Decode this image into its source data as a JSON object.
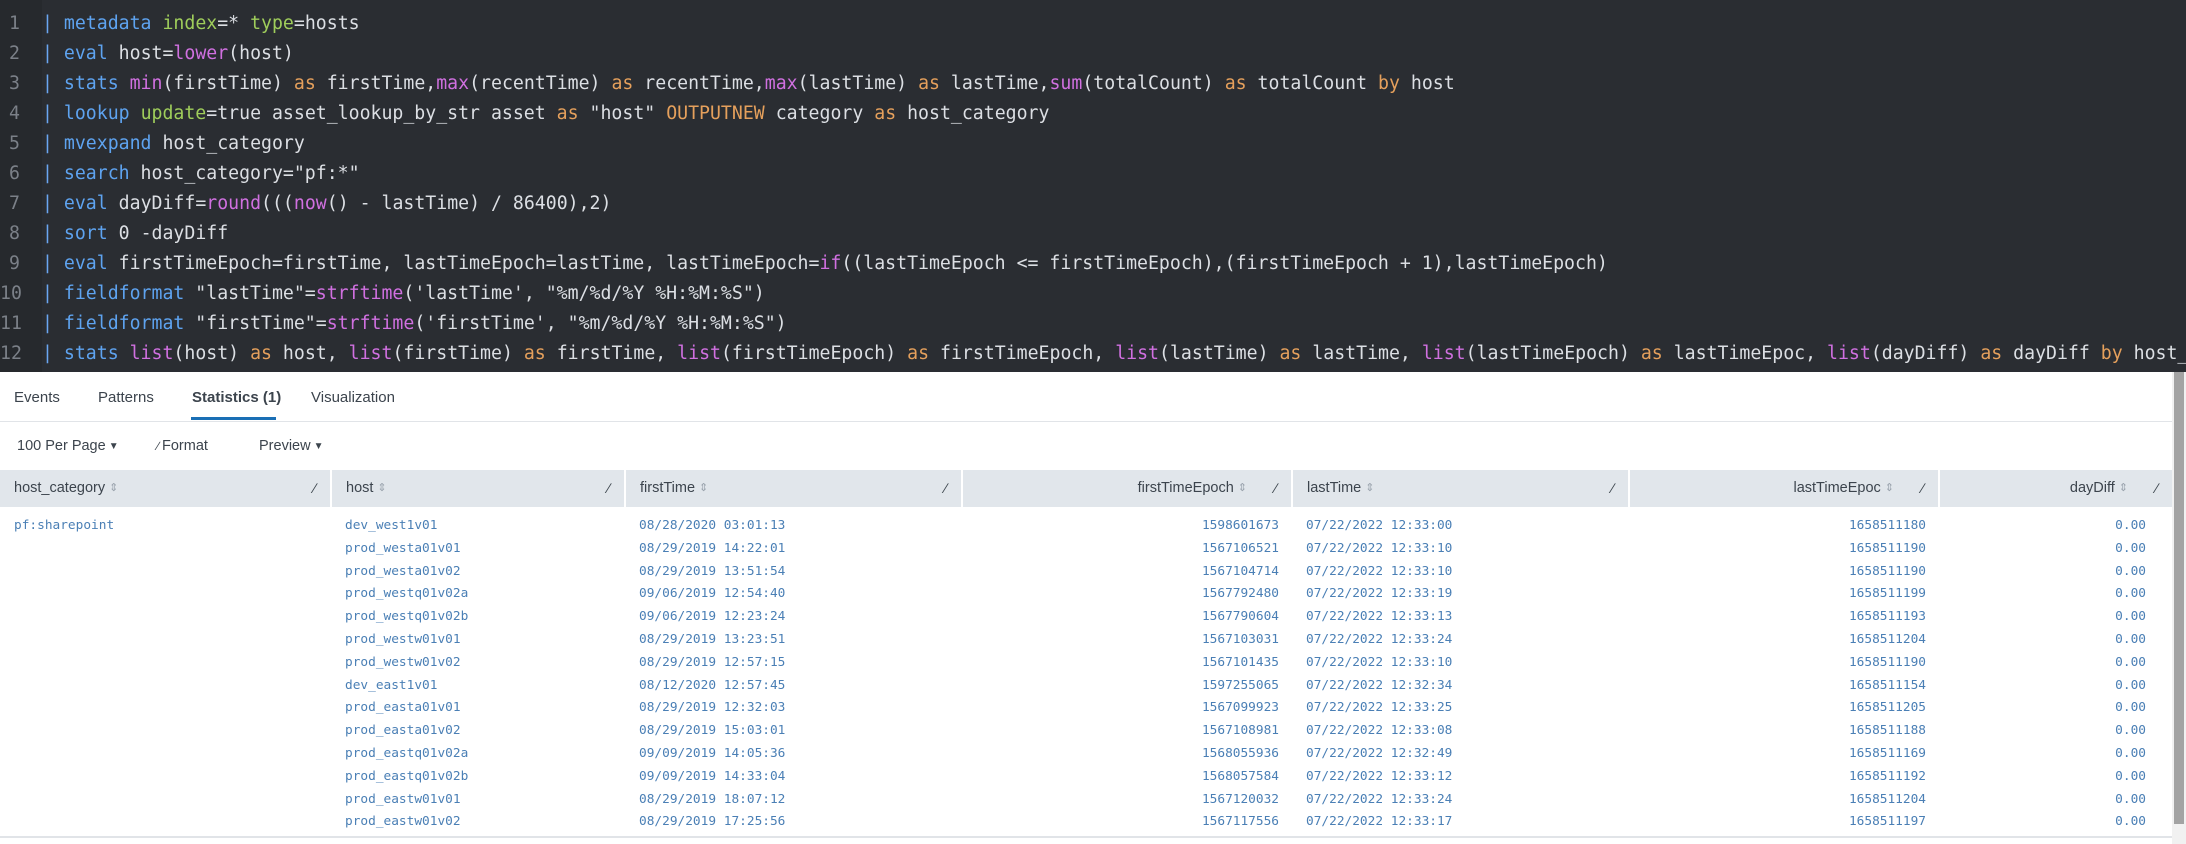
{
  "editor": {
    "lines": [
      {
        "num": "1",
        "tokens": [
          [
            "pipe",
            "| "
          ],
          [
            "cmd",
            "metadata"
          ],
          [
            "txt",
            " "
          ],
          [
            "arg",
            "index"
          ],
          [
            "txt",
            "=* "
          ],
          [
            "arg",
            "type"
          ],
          [
            "txt",
            "=hosts"
          ]
        ]
      },
      {
        "num": "2",
        "tokens": [
          [
            "pipe",
            "| "
          ],
          [
            "cmd",
            "eval"
          ],
          [
            "txt",
            " host="
          ],
          [
            "fn",
            "lower"
          ],
          [
            "txt",
            "(host)"
          ]
        ]
      },
      {
        "num": "3",
        "tokens": [
          [
            "pipe",
            "| "
          ],
          [
            "cmd",
            "stats"
          ],
          [
            "txt",
            " "
          ],
          [
            "fn",
            "min"
          ],
          [
            "txt",
            "(firstTime) "
          ],
          [
            "kw",
            "as"
          ],
          [
            "txt",
            " firstTime,"
          ],
          [
            "fn",
            "max"
          ],
          [
            "txt",
            "(recentTime) "
          ],
          [
            "kw",
            "as"
          ],
          [
            "txt",
            " recentTime,"
          ],
          [
            "fn",
            "max"
          ],
          [
            "txt",
            "(lastTime) "
          ],
          [
            "kw",
            "as"
          ],
          [
            "txt",
            " lastTime,"
          ],
          [
            "fn",
            "sum"
          ],
          [
            "txt",
            "(totalCount) "
          ],
          [
            "kw",
            "as"
          ],
          [
            "txt",
            " totalCount "
          ],
          [
            "kw",
            "by"
          ],
          [
            "txt",
            " host"
          ]
        ]
      },
      {
        "num": "4",
        "tokens": [
          [
            "pipe",
            "| "
          ],
          [
            "cmd",
            "lookup"
          ],
          [
            "txt",
            " "
          ],
          [
            "arg",
            "update"
          ],
          [
            "txt",
            "=true asset_lookup_by_str asset "
          ],
          [
            "kw",
            "as"
          ],
          [
            "txt",
            " \"host\" "
          ],
          [
            "kw",
            "OUTPUTNEW"
          ],
          [
            "txt",
            " category "
          ],
          [
            "kw",
            "as"
          ],
          [
            "txt",
            " host_category"
          ]
        ]
      },
      {
        "num": "5",
        "tokens": [
          [
            "pipe",
            "| "
          ],
          [
            "cmd",
            "mvexpand"
          ],
          [
            "txt",
            " host_category"
          ]
        ]
      },
      {
        "num": "6",
        "tokens": [
          [
            "pipe",
            "| "
          ],
          [
            "cmd",
            "search"
          ],
          [
            "txt",
            " host_category=\"pf:*\""
          ]
        ]
      },
      {
        "num": "7",
        "tokens": [
          [
            "pipe",
            "| "
          ],
          [
            "cmd",
            "eval"
          ],
          [
            "txt",
            " dayDiff="
          ],
          [
            "fn",
            "round"
          ],
          [
            "txt",
            "((("
          ],
          [
            "fn",
            "now"
          ],
          [
            "txt",
            "() - lastTime) / 86400),2)"
          ]
        ]
      },
      {
        "num": "8",
        "tokens": [
          [
            "pipe",
            "| "
          ],
          [
            "cmd",
            "sort"
          ],
          [
            "txt",
            " 0 -dayDiff"
          ]
        ]
      },
      {
        "num": "9",
        "tokens": [
          [
            "pipe",
            "| "
          ],
          [
            "cmd",
            "eval"
          ],
          [
            "txt",
            " firstTimeEpoch=firstTime, lastTimeEpoch=lastTime, lastTimeEpoch="
          ],
          [
            "fn",
            "if"
          ],
          [
            "txt",
            "((lastTimeEpoch <= firstTimeEpoch),(firstTimeEpoch + 1),lastTimeEpoch)"
          ]
        ]
      },
      {
        "num": "10",
        "tokens": [
          [
            "pipe",
            "| "
          ],
          [
            "cmd",
            "fieldformat"
          ],
          [
            "txt",
            " \"lastTime\"="
          ],
          [
            "fn",
            "strftime"
          ],
          [
            "txt",
            "('lastTime', \"%m/%d/%Y %H:%M:%S\")"
          ]
        ]
      },
      {
        "num": "11",
        "tokens": [
          [
            "pipe",
            "| "
          ],
          [
            "cmd",
            "fieldformat"
          ],
          [
            "txt",
            " \"firstTime\"="
          ],
          [
            "fn",
            "strftime"
          ],
          [
            "txt",
            "('firstTime', \"%m/%d/%Y %H:%M:%S\")"
          ]
        ]
      },
      {
        "num": "12",
        "tokens": [
          [
            "pipe",
            "| "
          ],
          [
            "cmd",
            "stats"
          ],
          [
            "txt",
            " "
          ],
          [
            "fn",
            "list"
          ],
          [
            "txt",
            "(host) "
          ],
          [
            "kw",
            "as"
          ],
          [
            "txt",
            " host, "
          ],
          [
            "fn",
            "list"
          ],
          [
            "txt",
            "(firstTime) "
          ],
          [
            "kw",
            "as"
          ],
          [
            "txt",
            " firstTime, "
          ],
          [
            "fn",
            "list"
          ],
          [
            "txt",
            "(firstTimeEpoch) "
          ],
          [
            "kw",
            "as"
          ],
          [
            "txt",
            " firstTimeEpoch, "
          ],
          [
            "fn",
            "list"
          ],
          [
            "txt",
            "(lastTime) "
          ],
          [
            "kw",
            "as"
          ],
          [
            "txt",
            " lastTime, "
          ],
          [
            "fn",
            "list"
          ],
          [
            "txt",
            "(lastTimeEpoch) "
          ],
          [
            "kw",
            "as"
          ],
          [
            "txt",
            " lastTimeEpoc, "
          ],
          [
            "fn",
            "list"
          ],
          [
            "txt",
            "(dayDiff) "
          ],
          [
            "kw",
            "as"
          ],
          [
            "txt",
            " dayDiff "
          ],
          [
            "kw",
            "by"
          ],
          [
            "txt",
            " host_category"
          ]
        ]
      }
    ]
  },
  "tabs": [
    {
      "label": "Events",
      "active": false
    },
    {
      "label": "Patterns",
      "active": false
    },
    {
      "label": "Statistics (1)",
      "active": true
    },
    {
      "label": "Visualization",
      "active": false
    }
  ],
  "toolbar": {
    "per_page": "100 Per Page",
    "format": "Format",
    "preview": "Preview"
  },
  "table": {
    "columns": [
      {
        "label": "host_category",
        "sort_icon": "sort-icon",
        "edit_icon": "pencil-icon"
      },
      {
        "label": "host",
        "sort_icon": "sort-icon",
        "edit_icon": "pencil-icon"
      },
      {
        "label": "firstTime",
        "sort_icon": "sort-icon",
        "edit_icon": "pencil-icon"
      },
      {
        "label": "firstTimeEpoch",
        "sort_icon": "sort-icon",
        "edit_icon": "pencil-icon"
      },
      {
        "label": "lastTime",
        "sort_icon": "sort-icon",
        "edit_icon": "pencil-icon"
      },
      {
        "label": "lastTimeEpoc",
        "sort_icon": "sort-icon",
        "edit_icon": "pencil-icon"
      },
      {
        "label": "dayDiff",
        "sort_icon": "sort-icon",
        "edit_icon": "pencil-icon"
      }
    ],
    "row": {
      "host_category": "pf:sharepoint",
      "host": [
        "dev_west1v01",
        "prod_westa01v01",
        "prod_westa01v02",
        "prod_westq01v02a",
        "prod_westq01v02b",
        "prod_westw01v01",
        "prod_westw01v02",
        "dev_east1v01",
        "prod_easta01v01",
        "prod_easta01v02",
        "prod_eastq01v02a",
        "prod_eastq01v02b",
        "prod_eastw01v01",
        "prod_eastw01v02"
      ],
      "firstTime": [
        "08/28/2020 03:01:13",
        "08/29/2019 14:22:01",
        "08/29/2019 13:51:54",
        "09/06/2019 12:54:40",
        "09/06/2019 12:23:24",
        "08/29/2019 13:23:51",
        "08/29/2019 12:57:15",
        "08/12/2020 12:57:45",
        "08/29/2019 12:32:03",
        "08/29/2019 15:03:01",
        "09/09/2019 14:05:36",
        "09/09/2019 14:33:04",
        "08/29/2019 18:07:12",
        "08/29/2019 17:25:56"
      ],
      "firstTimeEpoch": [
        "1598601673",
        "1567106521",
        "1567104714",
        "1567792480",
        "1567790604",
        "1567103031",
        "1567101435",
        "1597255065",
        "1567099923",
        "1567108981",
        "1568055936",
        "1568057584",
        "1567120032",
        "1567117556"
      ],
      "lastTime": [
        "07/22/2022 12:33:00",
        "07/22/2022 12:33:10",
        "07/22/2022 12:33:10",
        "07/22/2022 12:33:19",
        "07/22/2022 12:33:13",
        "07/22/2022 12:33:24",
        "07/22/2022 12:33:10",
        "07/22/2022 12:32:34",
        "07/22/2022 12:33:25",
        "07/22/2022 12:33:08",
        "07/22/2022 12:32:49",
        "07/22/2022 12:33:12",
        "07/22/2022 12:33:24",
        "07/22/2022 12:33:17"
      ],
      "lastTimeEpoc": [
        "1658511180",
        "1658511190",
        "1658511190",
        "1658511199",
        "1658511193",
        "1658511204",
        "1658511190",
        "1658511154",
        "1658511205",
        "1658511188",
        "1658511169",
        "1658511192",
        "1658511204",
        "1658511197"
      ],
      "dayDiff": [
        "0.00",
        "0.00",
        "0.00",
        "0.00",
        "0.00",
        "0.00",
        "0.00",
        "0.00",
        "0.00",
        "0.00",
        "0.00",
        "0.00",
        "0.00",
        "0.00"
      ]
    }
  },
  "colors": {
    "editor_bg": "#2a2d32",
    "cmd": "#5ea3f0",
    "arg": "#9fcd5b",
    "fn": "#d070e0",
    "kw": "#e5a05c",
    "text": "#dcdfe4",
    "cell_text": "#4a7fb5",
    "tab_accent": "#1a6fb5"
  }
}
